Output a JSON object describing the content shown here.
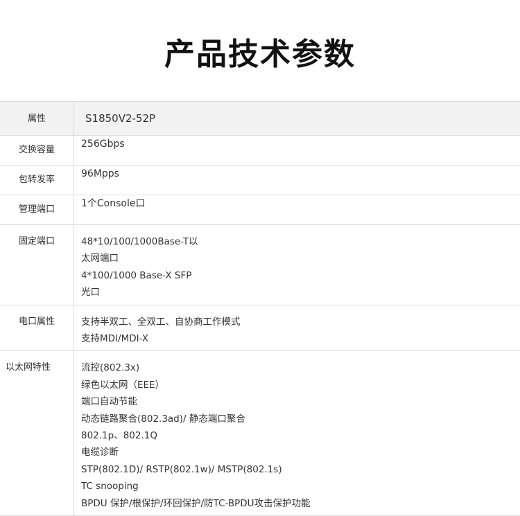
{
  "title": "产品技术参数",
  "header": {
    "label": "属性",
    "value": "S1850V2-52P"
  },
  "rows": [
    {
      "label": "交换容量",
      "lines": [
        "256Gbps"
      ]
    },
    {
      "label": "包转发率",
      "lines": [
        "96Mpps"
      ]
    },
    {
      "label": "管理端口",
      "lines": [
        "1个Console口"
      ]
    },
    {
      "label": "固定端口",
      "lines": [
        "48*10/100/1000Base-T以",
        "太网端口",
        "4*100/1000 Base-X SFP",
        "光口"
      ]
    },
    {
      "label": "电口属性",
      "lines": [
        "支持半双工、全双工、自协商工作模式",
        "支持MDI/MDI-X"
      ]
    },
    {
      "label": "以太网特性",
      "lines": [
        "流控(802.3x)",
        "绿色以太网（EEE）",
        "端口自动节能",
        "动态链路聚合(802.3ad)/ 静态端口聚合",
        "802.1p、802.1Q",
        "电缆诊断",
        "STP(802.1D)/ RSTP(802.1w)/ MSTP(802.1s)",
        "TC snooping",
        "BPDU 保护/根保护/环回保护/防TC-BPDU攻击保护功能"
      ]
    }
  ]
}
